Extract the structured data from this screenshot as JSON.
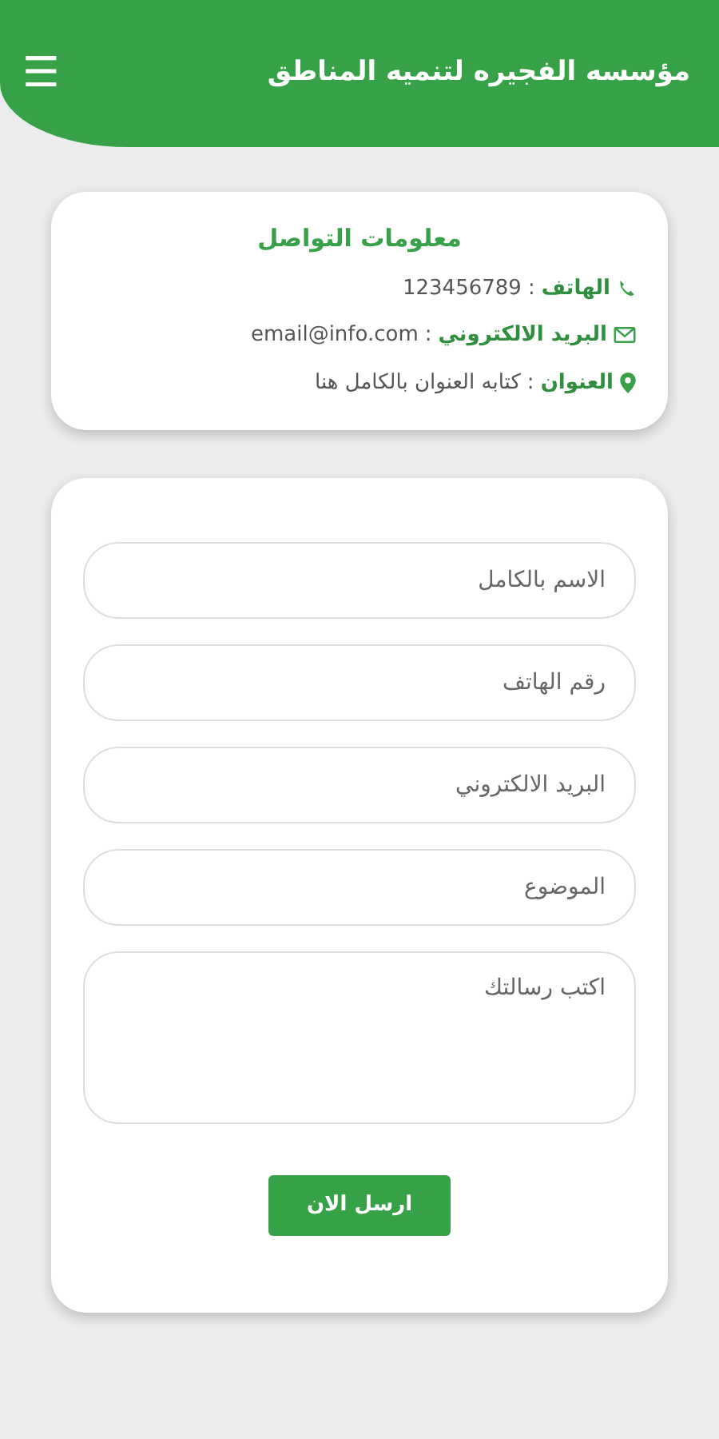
{
  "header": {
    "title": "مؤسسه الفجيره لتنميه المناطق",
    "menu_icon": "☰"
  },
  "contact_card": {
    "title": "معلومات التواصل",
    "rows": [
      {
        "kind": "phone",
        "label": "الهاتف",
        "separator": ":",
        "value": "123456789"
      },
      {
        "kind": "email",
        "label": "البريد الالكتروني",
        "separator": ":",
        "value": "email@info.com"
      },
      {
        "kind": "address",
        "label": "العنوان",
        "separator": ":",
        "value": "كتابه العنوان بالكامل هنا"
      }
    ]
  },
  "form": {
    "fields": [
      {
        "kind": "input",
        "placeholder": "الاسم بالكامل"
      },
      {
        "kind": "input",
        "placeholder": "رقم الهاتف"
      },
      {
        "kind": "input",
        "placeholder": "البريد الالكتروني"
      },
      {
        "kind": "input",
        "placeholder": "الموضوع"
      },
      {
        "kind": "textarea",
        "placeholder": "اكتب رسالتك"
      }
    ],
    "submit": "ارسل الان"
  }
}
